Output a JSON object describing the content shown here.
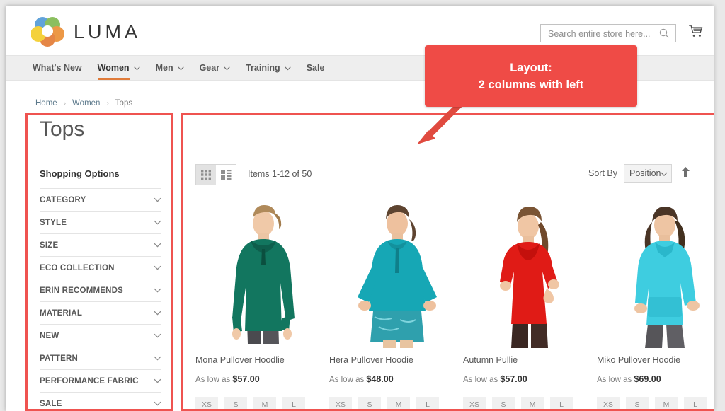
{
  "header": {
    "brand": "LUMA",
    "logo_icon": "luma-rings-logo",
    "logo_colors": [
      "#4a90d9",
      "#7cb342",
      "#e8821e",
      "#f2c811"
    ],
    "search": {
      "placeholder": "Search entire store here...",
      "value": "",
      "icon": "search-icon"
    },
    "cart_icon": "shopping-cart-icon"
  },
  "nav": {
    "items": [
      {
        "label": "What's New",
        "has_chevron": false,
        "active": false
      },
      {
        "label": "Women",
        "has_chevron": true,
        "active": true
      },
      {
        "label": "Men",
        "has_chevron": true,
        "active": false
      },
      {
        "label": "Gear",
        "has_chevron": true,
        "active": false
      },
      {
        "label": "Training",
        "has_chevron": true,
        "active": false
      },
      {
        "label": "Sale",
        "has_chevron": false,
        "active": false
      }
    ],
    "active_underline_color": "#e07b39"
  },
  "breadcrumb": {
    "items": [
      "Home",
      "Women",
      "Tops"
    ],
    "separator": "›"
  },
  "sidebar": {
    "category_title": "Tops",
    "shopping_options_label": "Shopping Options",
    "filters": [
      {
        "label": "CATEGORY",
        "icon": "chevron-down-icon"
      },
      {
        "label": "STYLE",
        "icon": "chevron-down-icon"
      },
      {
        "label": "SIZE",
        "icon": "chevron-down-icon"
      },
      {
        "label": "ECO COLLECTION",
        "icon": "chevron-down-icon"
      },
      {
        "label": "ERIN RECOMMENDS",
        "icon": "chevron-down-icon"
      },
      {
        "label": "MATERIAL",
        "icon": "chevron-down-icon"
      },
      {
        "label": "NEW",
        "icon": "chevron-down-icon"
      },
      {
        "label": "PATTERN",
        "icon": "chevron-down-icon"
      },
      {
        "label": "PERFORMANCE FABRIC",
        "icon": "chevron-down-icon"
      },
      {
        "label": "SALE",
        "icon": "chevron-down-icon"
      }
    ]
  },
  "toolbar": {
    "grid_view_icon": "grid-view-icon",
    "list_view_icon": "list-view-icon",
    "active_view": "grid",
    "items_count": "Items 1-12 of 50",
    "sort_label": "Sort By",
    "sort_value": "Position",
    "sort_chevron_icon": "chevron-down-icon",
    "sort_direction_icon": "arrow-up-icon"
  },
  "products": [
    {
      "name": "Mona Pullover Hoodlie",
      "price_prefix": "As low as",
      "price": "$57.00",
      "color": "#12765f",
      "pants": "#4a4a4f",
      "sizes": [
        "XS",
        "S",
        "M",
        "L"
      ]
    },
    {
      "name": "Hera Pullover Hoodie",
      "price_prefix": "As low as",
      "price": "$48.00",
      "color": "#16a7b5",
      "pants": "#2fa0ad",
      "sizes": [
        "XS",
        "S",
        "M",
        "L"
      ]
    },
    {
      "name": "Autumn Pullie",
      "price_prefix": "As low as",
      "price": "$57.00",
      "color": "#e01b16",
      "pants": "#3a2722",
      "sizes": [
        "XS",
        "S",
        "M",
        "L"
      ]
    },
    {
      "name": "Miko Pullover Hoodie",
      "price_prefix": "As low as",
      "price": "$69.00",
      "color": "#3ecde0",
      "pants": "#565559",
      "sizes": [
        "XS",
        "S",
        "M",
        "L"
      ]
    }
  ],
  "annotation": {
    "line1": "Layout:",
    "line2": "2 columns with left",
    "box_color": "#ef4b46",
    "highlight_border_color": "#ef5350",
    "arrow_icon": "arrow-down-left-icon"
  }
}
